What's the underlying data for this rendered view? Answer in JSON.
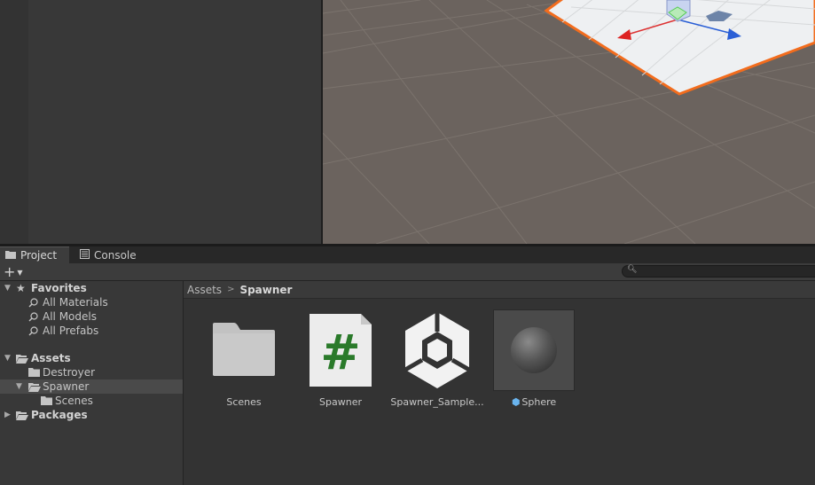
{
  "panels": {
    "tabs": [
      {
        "label": "Project",
        "icon": "folder-icon",
        "active": true
      },
      {
        "label": "Console",
        "icon": "console-icon",
        "active": false
      }
    ],
    "toolbar": {
      "add_label": "+",
      "add_icon": "plus-icon"
    },
    "tree": {
      "favorites": {
        "label": "Favorites",
        "items": [
          "All Materials",
          "All Models",
          "All Prefabs"
        ]
      },
      "assets": {
        "label": "Assets",
        "items": [
          "Destroyer",
          "Spawner",
          "Scenes"
        ]
      },
      "packages": {
        "label": "Packages"
      }
    },
    "breadcrumb": {
      "root": "Assets",
      "current": "Spawner"
    },
    "assets": [
      {
        "name": "Scenes",
        "icon": "folder-icon"
      },
      {
        "name": "Spawner",
        "icon": "csharp-script-icon"
      },
      {
        "name": "Spawner_Sample...",
        "icon": "unity-scene-icon"
      },
      {
        "name": "Sphere",
        "icon": "sphere-prefab-icon",
        "selected": true
      }
    ]
  },
  "colors": {
    "accent_orange": "#f26c1d",
    "scene_ground": "#6b635e",
    "script_hash": "#2a7a2a",
    "selection": "#4a4a4a"
  }
}
